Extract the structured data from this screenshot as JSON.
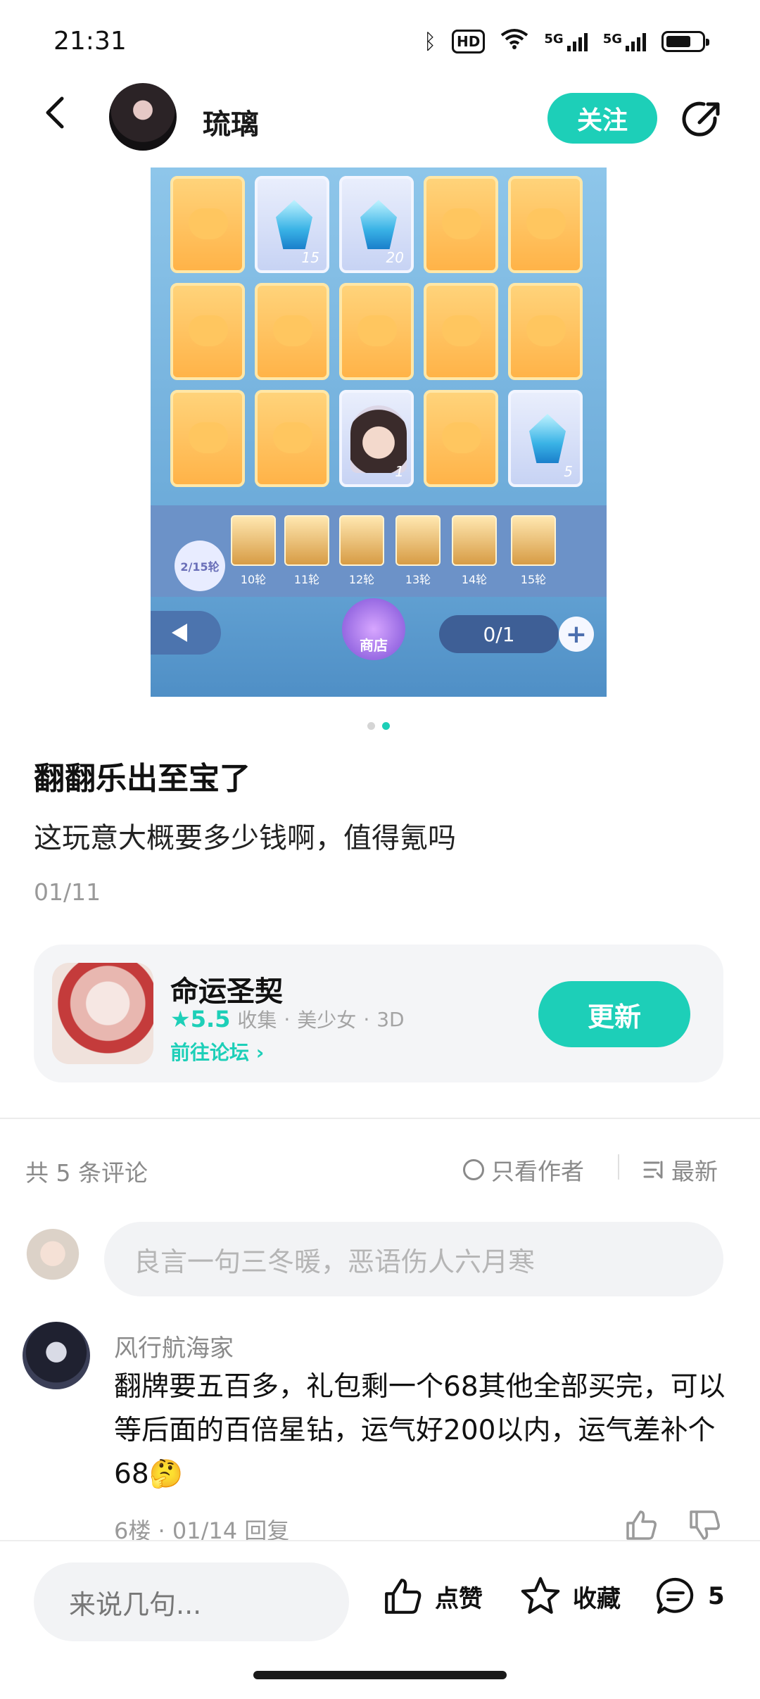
{
  "status": {
    "time": "21:31",
    "hd_label": "HD",
    "net1": "5G",
    "net2": "5G"
  },
  "header": {
    "username": "琉璃",
    "follow_label": "关注"
  },
  "screenshot": {
    "card_qty": [
      "15",
      "20",
      "1",
      "5"
    ],
    "round_badge": "2/15轮",
    "rounds": [
      "10轮",
      "11轮",
      "12轮",
      "13轮",
      "14轮",
      "15轮"
    ],
    "shop_label": "商店",
    "counter": "0/1"
  },
  "post": {
    "title": "翻翻乐出至宝了",
    "body": "这玩意大概要多少钱啊，值得氪吗",
    "date": "01/11"
  },
  "game": {
    "name": "命运圣契",
    "rating": "5.5",
    "tags": [
      "收集",
      "美少女",
      "3D"
    ],
    "forum_link": "前往论坛",
    "update_label": "更新"
  },
  "comments_bar": {
    "count_text": "共 5 条评论",
    "only_author": "只看作者",
    "sort": "最新"
  },
  "comment_input": {
    "placeholder": "良言一句三冬暖，恶语伤人六月寒"
  },
  "comment": {
    "author": "风行航海家",
    "text": "翻牌要五百多，礼包剩一个68其他全部买完，可以等后面的百倍星钻，运气好200以内，运气差补个68🤔",
    "meta": "6楼 · 01/14  回复"
  },
  "bottom": {
    "say_placeholder": "来说几句...",
    "like_label": "点赞",
    "fav_label": "收藏",
    "comment_count": "5"
  },
  "colors": {
    "accent": "#1dcfb8"
  }
}
